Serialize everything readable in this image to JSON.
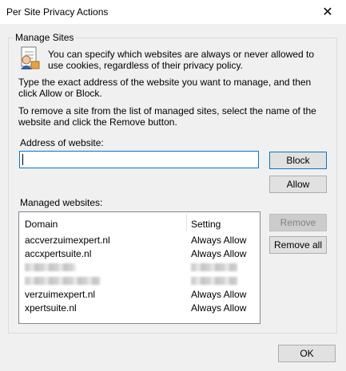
{
  "window": {
    "title": "Per Site Privacy Actions",
    "close_glyph": "✕"
  },
  "group": {
    "label": "Manage Sites",
    "intro": "You can specify which websites are always or never allowed to use cookies, regardless of their privacy policy.",
    "instruction_add": "Type the exact address of the website you want to manage, and then click Allow or Block.",
    "instruction_remove": "To remove a site from the list of managed sites, select the name of the website and click the Remove button."
  },
  "address": {
    "label": "Address of website:",
    "value": ""
  },
  "buttons": {
    "block": "Block",
    "allow": "Allow",
    "remove": "Remove",
    "remove_all": "Remove all",
    "ok": "OK"
  },
  "managed": {
    "label": "Managed websites:",
    "columns": {
      "domain": "Domain",
      "setting": "Setting"
    },
    "rows": [
      {
        "domain": "accverzuimexpert.nl",
        "setting": "Always Allow",
        "obscured": false
      },
      {
        "domain": "accxpertsuite.nl",
        "setting": "Always Allow",
        "obscured": false
      },
      {
        "domain": "",
        "setting": "",
        "obscured": true
      },
      {
        "domain": "",
        "setting": "",
        "obscured": true
      },
      {
        "domain": "verzuimexpert.nl",
        "setting": "Always Allow",
        "obscured": false
      },
      {
        "domain": "xpertsuite.nl",
        "setting": "Always Allow",
        "obscured": false
      }
    ]
  },
  "icons": {
    "privacy": "privacy-report-icon",
    "close": "close-icon"
  },
  "colors": {
    "focus_border": "#0078d7",
    "button_face": "#e1e1e1",
    "window_bg": "#f0f0f0"
  }
}
